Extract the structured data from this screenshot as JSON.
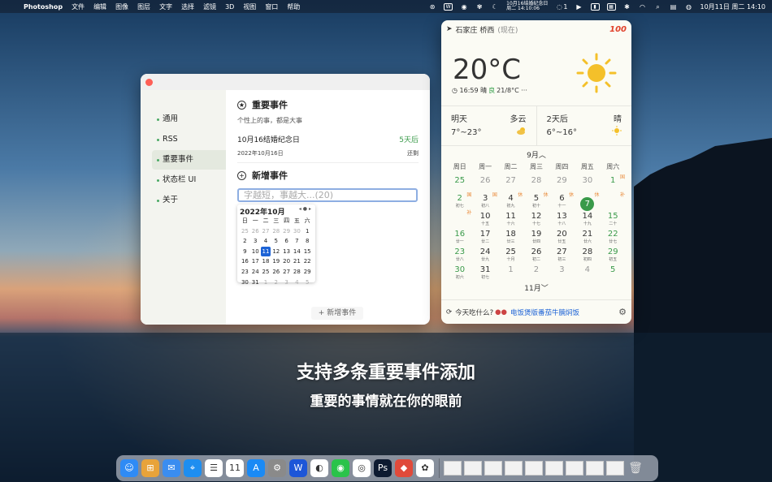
{
  "menubar": {
    "apple_icon": "apple-logo-icon",
    "app_name": "Photoshop",
    "menus": [
      "文件",
      "编辑",
      "图像",
      "图层",
      "文字",
      "选择",
      "滤镜",
      "3D",
      "视图",
      "窗口",
      "帮助"
    ],
    "reminder_line1": "10月16结婚纪念日",
    "reminder_line2": "周二 14:10:06",
    "badge_count": "1",
    "clock": "10月11日 周二 14:10"
  },
  "settings_window": {
    "sidebar": [
      "通用",
      "RSS",
      "重要事件",
      "状态栏 UI",
      "关于"
    ],
    "important_title": "重要事件",
    "important_subtitle": "个性上的事，都是大事",
    "event_name": "10月16结婚纪念日",
    "event_days": "5天后",
    "event_date": "2022年10月16日",
    "event_action": "还剩",
    "add_title": "新增事件",
    "input_placeholder": "字越短，事越大...(20)",
    "picker": {
      "month": "2022年10月",
      "weekdays": [
        "日",
        "一",
        "二",
        "三",
        "四",
        "五",
        "六"
      ],
      "rows": [
        [
          "25",
          "26",
          "27",
          "28",
          "29",
          "30",
          "1"
        ],
        [
          "2",
          "3",
          "4",
          "5",
          "6",
          "7",
          "8"
        ],
        [
          "9",
          "10",
          "11",
          "12",
          "13",
          "14",
          "15"
        ],
        [
          "16",
          "17",
          "18",
          "19",
          "20",
          "21",
          "22"
        ],
        [
          "23",
          "24",
          "25",
          "26",
          "27",
          "28",
          "29"
        ],
        [
          "30",
          "31",
          "1",
          "2",
          "3",
          "4",
          "5"
        ]
      ],
      "selected": "11"
    },
    "add_button": "+ 新增事件"
  },
  "weather": {
    "location": "石家庄 桥西",
    "location_note": "(现在)",
    "badge": "100",
    "temperature": "20°C",
    "time": "16:59",
    "condition": "晴",
    "aqi": "良",
    "range": "21/8°C",
    "more": "···",
    "tomorrow": {
      "label": "明天",
      "condition": "多云",
      "range": "7°~23°"
    },
    "after2": {
      "label": "2天后",
      "condition": "晴",
      "range": "6°~16°"
    },
    "calendar": {
      "prev_month": "9月",
      "next_month": "11月",
      "weekdays": [
        "周日",
        "周一",
        "周二",
        "周三",
        "周四",
        "周五",
        "周六"
      ],
      "rows": [
        [
          {
            "d": "25",
            "l": "",
            "o": true
          },
          {
            "d": "26",
            "l": "",
            "o": true
          },
          {
            "d": "27",
            "l": "",
            "o": true
          },
          {
            "d": "28",
            "l": "",
            "o": true
          },
          {
            "d": "29",
            "l": "",
            "o": true
          },
          {
            "d": "30",
            "l": "",
            "o": true
          },
          {
            "d": "1",
            "l": "",
            "tag": "国"
          }
        ],
        [
          {
            "d": "2",
            "l": "初七",
            "tag": "国"
          },
          {
            "d": "3",
            "l": "初八",
            "tag": "国"
          },
          {
            "d": "4",
            "l": "初九",
            "tag": "休"
          },
          {
            "d": "5",
            "l": "初十",
            "tag": "休"
          },
          {
            "d": "6",
            "l": "十一",
            "tag": "休"
          },
          {
            "d": "7",
            "l": "",
            "tag": "休",
            "today": true
          },
          {
            "d": "",
            "l": "",
            "tag": "补"
          }
        ],
        [
          {
            "d": "",
            "l": "",
            "tag": "补"
          },
          {
            "d": "10",
            "l": "十五"
          },
          {
            "d": "11",
            "l": "十六"
          },
          {
            "d": "12",
            "l": "十七"
          },
          {
            "d": "13",
            "l": "十八"
          },
          {
            "d": "14",
            "l": "十九"
          },
          {
            "d": "15",
            "l": "二十"
          }
        ],
        [
          {
            "d": "16",
            "l": "廿一"
          },
          {
            "d": "17",
            "l": "廿二"
          },
          {
            "d": "18",
            "l": "廿三"
          },
          {
            "d": "19",
            "l": "廿四"
          },
          {
            "d": "20",
            "l": "廿五"
          },
          {
            "d": "21",
            "l": "廿六"
          },
          {
            "d": "22",
            "l": "廿七"
          }
        ],
        [
          {
            "d": "23",
            "l": "廿八"
          },
          {
            "d": "24",
            "l": "廿九"
          },
          {
            "d": "25",
            "l": "十月"
          },
          {
            "d": "26",
            "l": "初二"
          },
          {
            "d": "27",
            "l": "初三"
          },
          {
            "d": "28",
            "l": "初四"
          },
          {
            "d": "29",
            "l": "初五"
          }
        ],
        [
          {
            "d": "30",
            "l": "初六"
          },
          {
            "d": "31",
            "l": "初七"
          },
          {
            "d": "1",
            "l": "",
            "o": true
          },
          {
            "d": "2",
            "l": "",
            "o": true
          },
          {
            "d": "3",
            "l": "",
            "o": true
          },
          {
            "d": "4",
            "l": "",
            "o": true
          },
          {
            "d": "5",
            "l": "",
            "o": true
          }
        ]
      ]
    },
    "food_prompt": "今天吃什么?",
    "food_dish": "电饭煲版番茄牛腩焖饭"
  },
  "captions": {
    "line1": "支持多条重要事件添加",
    "line2": "重要的事情就在你的眼前"
  },
  "dock": {
    "apps": [
      {
        "name": "finder-icon",
        "color": "#2f8bf5",
        "glyph": "☺"
      },
      {
        "name": "launchpad-icon",
        "color": "#e8a33a",
        "glyph": "⊞"
      },
      {
        "name": "mail-icon",
        "color": "#3a8df0",
        "glyph": "✉"
      },
      {
        "name": "safari-icon",
        "color": "#1e8ef0",
        "glyph": "⌖"
      },
      {
        "name": "reminders-icon",
        "color": "#ffffff",
        "glyph": "☰"
      },
      {
        "name": "calendar-icon",
        "color": "#ffffff",
        "glyph": "11"
      },
      {
        "name": "app-store-icon",
        "color": "#1a8af5",
        "glyph": "A"
      },
      {
        "name": "system-settings-icon",
        "color": "#8a8a8a",
        "glyph": "⚙"
      },
      {
        "name": "wps-icon",
        "color": "#1d56d8",
        "glyph": "W"
      },
      {
        "name": "qq-icon",
        "color": "#ffffff",
        "glyph": "◐"
      },
      {
        "name": "wechat-icon",
        "color": "#2ac34a",
        "glyph": "◉"
      },
      {
        "name": "chrome-icon",
        "color": "#ffffff",
        "glyph": "◎"
      },
      {
        "name": "photoshop-icon",
        "color": "#0d1a30",
        "glyph": "Ps"
      },
      {
        "name": "pdf-reader-icon",
        "color": "#e04a3a",
        "glyph": "◆"
      },
      {
        "name": "cloud-app-icon",
        "color": "#ffffff",
        "glyph": "✿"
      }
    ],
    "trash_icon": "trash-icon"
  }
}
